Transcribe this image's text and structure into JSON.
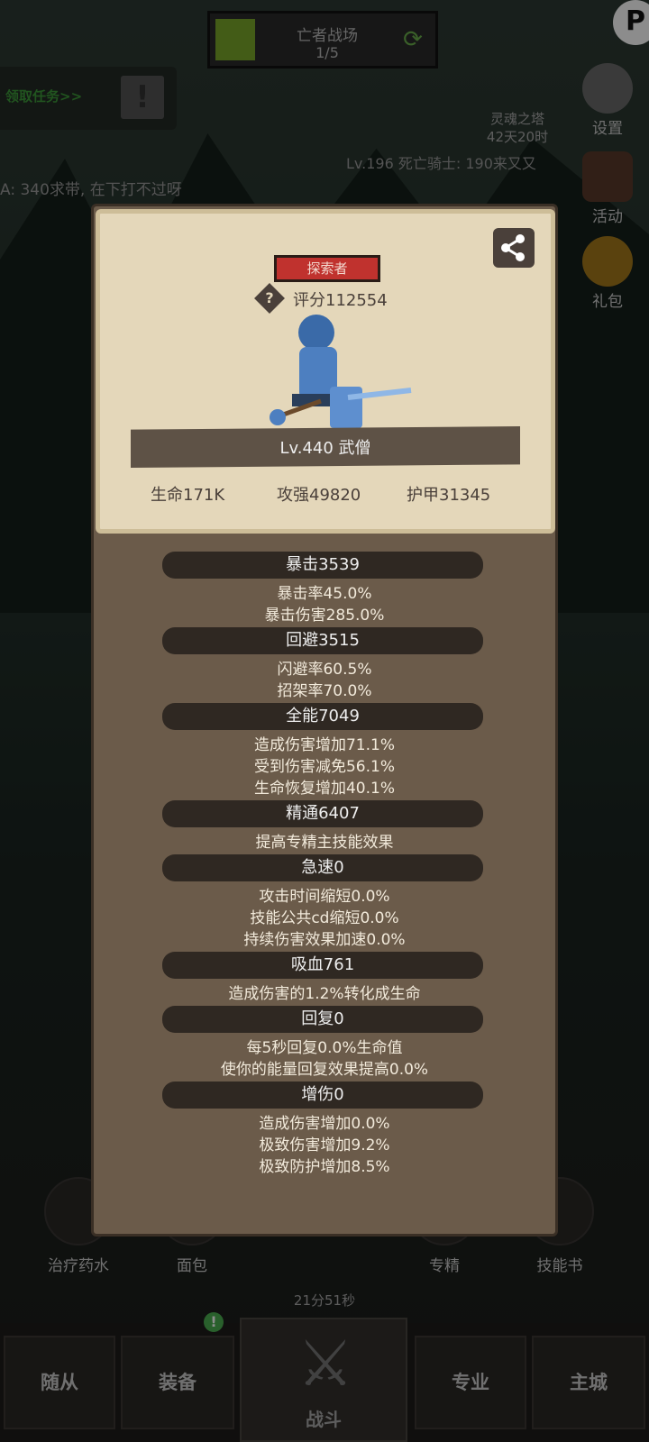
{
  "top": {
    "arena_title": "亡者战场",
    "arena_progress": "1/5",
    "quest_label": "领取任务>>",
    "soul_tower_name": "灵魂之塔",
    "soul_tower_time": "42天20时",
    "settings_label": "设置",
    "activity_label": "活动",
    "gift_label": "礼包",
    "chat_line1": "Lv.196 死亡骑士: 190来又又",
    "chat_line2": "A: 340求带, 在下打不过呀"
  },
  "card": {
    "badge": "探索者",
    "score": "评分112554",
    "level_class": "Lv.440 武僧",
    "hp": "生命171K",
    "atk": "攻强49820",
    "armor": "护甲31345"
  },
  "attributes": [
    {
      "title": "暴击3539",
      "lines": [
        "暴击率45.0%",
        "暴击伤害285.0%"
      ]
    },
    {
      "title": "回避3515",
      "lines": [
        "闪避率60.5%",
        "招架率70.0%"
      ]
    },
    {
      "title": "全能7049",
      "lines": [
        "造成伤害增加71.1%",
        "受到伤害减免56.1%",
        "生命恢复增加40.1%"
      ]
    },
    {
      "title": "精通6407",
      "lines": [
        "提高专精主技能效果"
      ]
    },
    {
      "title": "急速0",
      "lines": [
        "攻击时间缩短0.0%",
        "技能公共cd缩短0.0%",
        "持续伤害效果加速0.0%"
      ]
    },
    {
      "title": "吸血761",
      "lines": [
        "造成伤害的1.2%转化成生命"
      ]
    },
    {
      "title": "回复0",
      "lines": [
        "每5秒回复0.0%生命值",
        "使你的能量回复效果提高0.0%"
      ]
    },
    {
      "title": "增伤0",
      "lines": [
        "造成伤害增加0.0%",
        "极致伤害增加9.2%",
        "极致防护增加8.5%"
      ]
    }
  ],
  "bottom": {
    "potion": "治疗药水",
    "bread": "面包",
    "timer": "21分51秒",
    "spec": "专精",
    "skillbook": "技能书",
    "tabs": [
      "随从",
      "装备",
      "战斗",
      "专业",
      "主城"
    ],
    "equip_notice": "!"
  },
  "colors": {
    "panel_bg": "#6b5b4a",
    "card_bg": "#e4d7ba",
    "badge_red": "#c0322e",
    "stat_pill": "#2f2822",
    "quest_green": "#3d9a3a"
  }
}
